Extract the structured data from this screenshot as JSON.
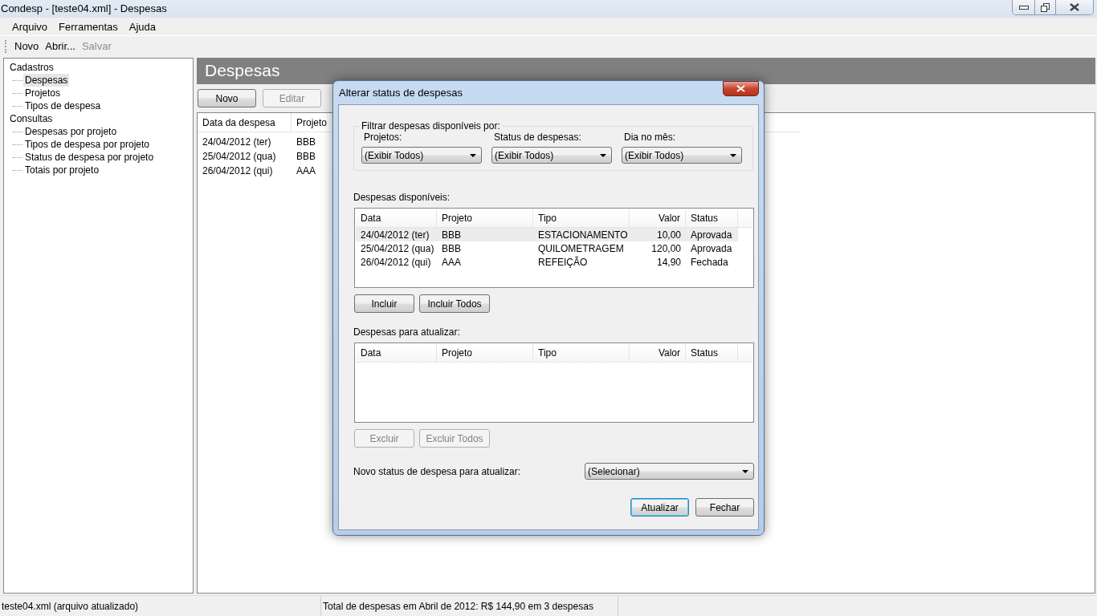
{
  "window": {
    "title": "Condesp - [teste04.xml] - Despesas"
  },
  "menu": [
    "Arquivo",
    "Ferramentas",
    "Ajuda"
  ],
  "toolbar": [
    {
      "label": "Novo",
      "disabled": false
    },
    {
      "label": "Abrir...",
      "disabled": false
    },
    {
      "label": "Salvar",
      "disabled": true
    }
  ],
  "tree": [
    {
      "label": "Cadastros",
      "selected": false,
      "children": [
        {
          "label": "Despesas",
          "selected": true
        },
        {
          "label": "Projetos",
          "selected": false
        },
        {
          "label": "Tipos de despesa",
          "selected": false
        }
      ]
    },
    {
      "label": "Consultas",
      "selected": false,
      "children": [
        {
          "label": "Despesas por projeto",
          "selected": false
        },
        {
          "label": "Tipos de despesa por projeto",
          "selected": false
        },
        {
          "label": "Status de despesa por projeto",
          "selected": false
        },
        {
          "label": "Totais por projeto",
          "selected": false
        }
      ]
    }
  ],
  "page": {
    "title": "Despesas",
    "buttons": [
      {
        "label": "Novo",
        "disabled": false
      },
      {
        "label": "Editar",
        "disabled": true
      }
    ],
    "table": {
      "columns": [
        "Data da despesa",
        "Projeto"
      ],
      "rows": [
        [
          "24/04/2012 (ter)",
          "BBB"
        ],
        [
          "25/04/2012 (qua)",
          "BBB"
        ],
        [
          "26/04/2012 (qui)",
          "AAA"
        ]
      ]
    }
  },
  "dialog": {
    "title": "Alterar status de despesas",
    "filter": {
      "legend": "Filtrar despesas disponíveis por:",
      "fields": [
        {
          "label": "Projetos:",
          "value": "(Exibir Todos)"
        },
        {
          "label": "Status de despesas:",
          "value": "(Exibir Todos)"
        },
        {
          "label": "Dia no mês:",
          "value": "(Exibir Todos)"
        }
      ]
    },
    "available": {
      "label": "Despesas disponíveis:",
      "columns": [
        "Data",
        "Projeto",
        "Tipo",
        "Valor",
        "Status"
      ],
      "rows": [
        {
          "cells": [
            "24/04/2012 (ter)",
            "BBB",
            "ESTACIONAMENTO",
            "10,00",
            "Aprovada"
          ],
          "selected": true
        },
        {
          "cells": [
            "25/04/2012 (qua)",
            "BBB",
            "QUILOMETRAGEM",
            "120,00",
            "Aprovada"
          ],
          "selected": false
        },
        {
          "cells": [
            "26/04/2012 (qui)",
            "AAA",
            "REFEIÇÃO",
            "14,90",
            "Fechada"
          ],
          "selected": false
        }
      ],
      "buttons": [
        {
          "label": "Incluir",
          "disabled": false
        },
        {
          "label": "Incluir Todos",
          "disabled": false
        }
      ]
    },
    "to_update": {
      "label": "Despesas para atualizar:",
      "columns": [
        "Data",
        "Projeto",
        "Tipo",
        "Valor",
        "Status"
      ],
      "buttons": [
        {
          "label": "Excluir",
          "disabled": true
        },
        {
          "label": "Excluir Todos",
          "disabled": true
        }
      ]
    },
    "new_status": {
      "label": "Novo status de despesa para atualizar:",
      "value": "(Selecionar)"
    },
    "buttons": [
      {
        "label": "Atualizar",
        "default": true
      },
      {
        "label": "Fechar",
        "default": false
      }
    ]
  },
  "status_bar": [
    "teste04.xml (arquivo atualizado)",
    "Total de despesas em Abril de 2012:  R$ 144,90 em 3 despesas"
  ]
}
